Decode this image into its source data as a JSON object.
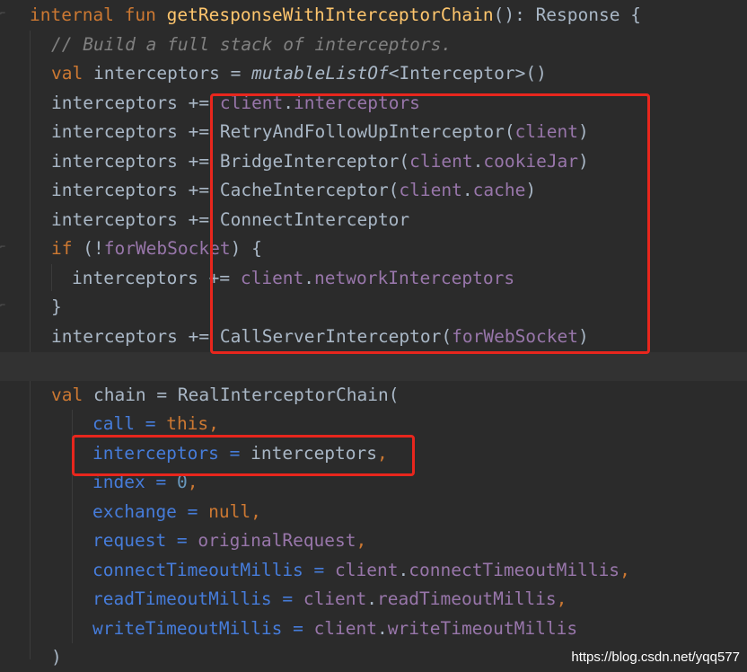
{
  "code": {
    "line1": {
      "kw1": "internal",
      "kw2": "fun",
      "fname": "getResponseWithInterceptorChain",
      "rest": "(): Response {"
    },
    "line2": {
      "comment": "// Build a full stack of interceptors."
    },
    "line3": {
      "kw": "val",
      "a": " interceptors = ",
      "call": "mutableListOf",
      "b": "<Interceptor>()"
    },
    "line4": {
      "a": "interceptors += ",
      "p1": "client",
      "dot": ".",
      "p2": "interceptors"
    },
    "line5": {
      "a": "interceptors += RetryAndFollowUpInterceptor(",
      "p1": "client",
      "b": ")"
    },
    "line6": {
      "a": "interceptors += BridgeInterceptor(",
      "p1": "client",
      "dot": ".",
      "p2": "cookieJar",
      "b": ")"
    },
    "line7": {
      "a": "interceptors += CacheInterceptor(",
      "p1": "client",
      "dot": ".",
      "p2": "cache",
      "b": ")"
    },
    "line8": {
      "a": "interceptors += ConnectInterceptor"
    },
    "line9": {
      "kw": "if",
      "a": " (!",
      "p1": "forWebSocket",
      "b": ") {"
    },
    "line10": {
      "a": "interceptors += ",
      "p1": "client",
      "dot": ".",
      "p2": "networkInterceptors"
    },
    "line11": {
      "a": "}"
    },
    "line12": {
      "a": "interceptors += CallServerInterceptor(",
      "p1": "forWebSocket",
      "b": ")"
    },
    "line14": {
      "kw": "val",
      "a": " chain = RealInterceptorChain("
    },
    "line15": {
      "pn": "call",
      "eq": " = ",
      "kw": "this",
      "c": ","
    },
    "line16": {
      "pn": "interceptors",
      "eq": " = ",
      "v": "interceptors",
      "c": ","
    },
    "line17": {
      "pn": "index",
      "eq": " = ",
      "nm": "0",
      "c": ","
    },
    "line18": {
      "pn": "exchange",
      "eq": " = ",
      "kw": "null",
      "c": ","
    },
    "line19": {
      "pn": "request",
      "eq": " = ",
      "pp": "originalRequest",
      "c": ","
    },
    "line20": {
      "pn": "connectTimeoutMillis",
      "eq": " = ",
      "p1": "client",
      "dot": ".",
      "p2": "connectTimeoutMillis",
      "c": ","
    },
    "line21": {
      "pn": "readTimeoutMillis",
      "eq": " = ",
      "p1": "client",
      "dot": ".",
      "p2": "readTimeoutMillis",
      "c": ","
    },
    "line22": {
      "pn": "writeTimeoutMillis",
      "eq": " = ",
      "p1": "client",
      "dot": ".",
      "p2": "writeTimeoutMillis"
    },
    "line23": {
      "a": ")"
    }
  },
  "watermark": "https://blog.csdn.net/yqq577",
  "colors": {
    "background": "#2b2b2b",
    "keyword": "#cc7832",
    "function": "#ffc66d",
    "comment": "#808080",
    "property": "#9876aa",
    "number": "#6897bb",
    "param": "#467cda",
    "highlight_box": "#e8261d"
  }
}
